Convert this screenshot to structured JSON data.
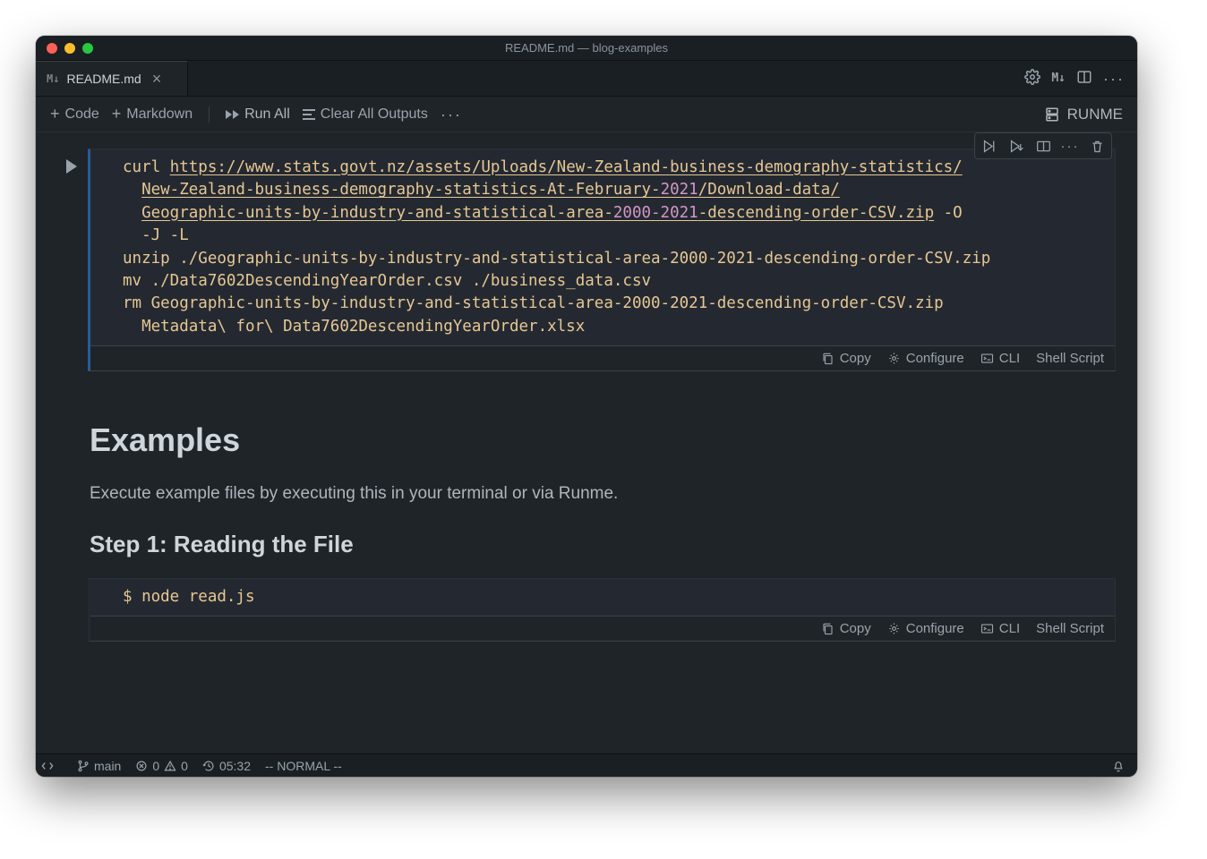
{
  "title": "README.md — blog-examples",
  "tab": {
    "icon_text": "M↓",
    "label": "README.md"
  },
  "tab_actions": {
    "m_arrow": "M↓",
    "dots": "···"
  },
  "toolbar": {
    "code": "Code",
    "markdown": "Markdown",
    "run_all": "Run All",
    "clear": "Clear All Outputs",
    "more": "···",
    "runme": "RUNME"
  },
  "cell1": {
    "code": {
      "l1_pre": "curl ",
      "l1_url": "https://www.stats.govt.nz/assets/Uploads/New-Zealand-business-demography-statistics/",
      "l2_url_a": "New-Zealand-business-demography-statistics-At-February-",
      "l2_url_year": "2021",
      "l2_url_b": "/Download-data/",
      "l3_url_a": "Geographic-units-by-industry-and-statistical-area-",
      "l3_url_years": "2000-2021",
      "l3_url_b": "-descending-order-CSV.zip",
      "l3_tail": " -O ",
      "l4": "  -J -L",
      "l5a": "unzip ",
      "l5b": "./Geographic-units-by-industry-and-statistical-area-2000-2021-descending-order-CSV.zip",
      "l6": "mv ./Data7602DescendingYearOrder.csv ./business_data.csv",
      "l7a": "rm ",
      "l7b": "Geographic-units-by-industry-and-statistical-area-2000-2021-descending-order-CSV.zip ",
      "l8": "  Metadata\\ for\\ Data7602DescendingYearOrder.xlsx"
    },
    "footer": {
      "copy": "Copy",
      "configure": "Configure",
      "cli": "CLI",
      "lang": "Shell Script"
    }
  },
  "markdown": {
    "h1": "Examples",
    "p": "Execute example files by executing this in your terminal or via Runme.",
    "h2": "Step 1: Reading the File"
  },
  "cell2": {
    "code": "$ node read.js",
    "footer": {
      "copy": "Copy",
      "configure": "Configure",
      "cli": "CLI",
      "lang": "Shell Script"
    }
  },
  "status": {
    "branch": "main",
    "errors": "0",
    "warnings": "0",
    "time": "05:32",
    "mode": "-- NORMAL --"
  }
}
